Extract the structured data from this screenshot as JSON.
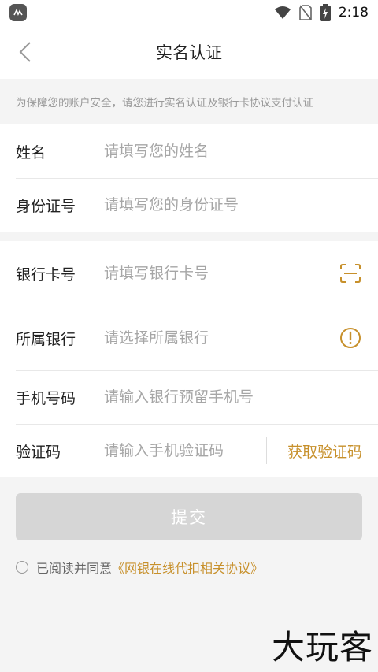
{
  "status": {
    "time": "2:18"
  },
  "header": {
    "title": "实名认证"
  },
  "notice": "为保障您的账户安全，请您进行实名认证及银行卡协议支付认证",
  "identity": {
    "name_label": "姓名",
    "name_placeholder": "请填写您的姓名",
    "id_label": "身份证号",
    "id_placeholder": "请填写您的身份证号"
  },
  "bank": {
    "card_label": "银行卡号",
    "card_placeholder": "请填写银行卡号",
    "bank_label": "所属银行",
    "bank_placeholder": "请选择所属银行",
    "phone_label": "手机号码",
    "phone_placeholder": "请输入银行预留手机号",
    "code_label": "验证码",
    "code_placeholder": "请输入手机验证码",
    "get_code": "获取验证码"
  },
  "submit_label": "提交",
  "agreement": {
    "prefix": "已阅读并同意",
    "link": "《网银在线代扣相关协议》"
  },
  "watermark": "大玩客",
  "colors": {
    "accent": "#c7902b",
    "disabled": "#d6d6d6"
  },
  "icons": [
    "app-badge-icon",
    "wifi-icon",
    "no-sim-icon",
    "battery-charging-icon",
    "back-arrow-icon",
    "scan-card-icon",
    "info-alert-icon"
  ]
}
